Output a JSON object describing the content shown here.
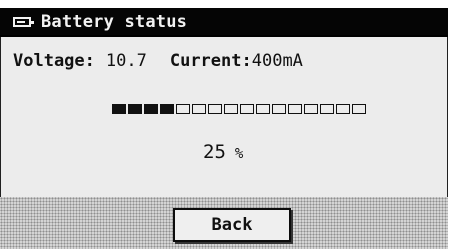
{
  "window": {
    "title": "Battery status",
    "icon": "battery-icon"
  },
  "status": {
    "voltage_label": "Voltage:",
    "voltage_value": "10.7",
    "current_label": "Current:",
    "current_value": "400mA"
  },
  "battery": {
    "filled_segments": 4,
    "total_segments": 16,
    "percent_value": "25",
    "percent_unit": "%"
  },
  "footer": {
    "back_label": "Back"
  },
  "colors": {
    "titlebar": "#050505",
    "screen_background": "#ececec",
    "text": "#111111",
    "footer_pattern": "#d4d4d4"
  }
}
